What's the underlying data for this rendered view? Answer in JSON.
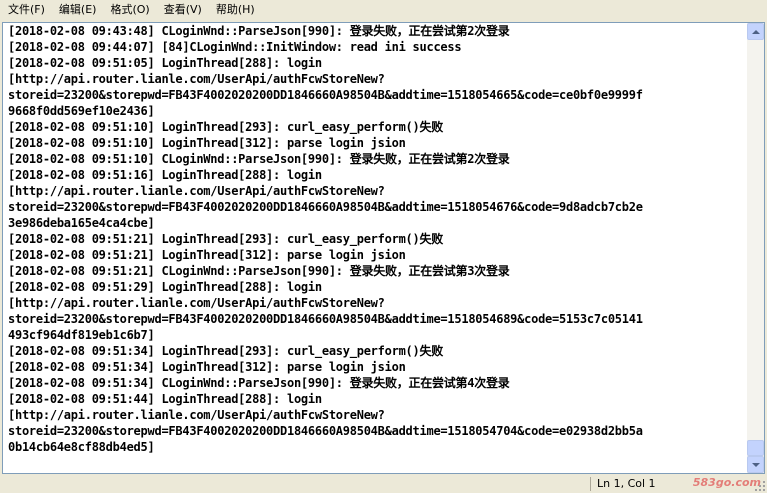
{
  "menu": {
    "items": [
      "文件(F)",
      "编辑(E)",
      "格式(O)",
      "查看(V)",
      "帮助(H)"
    ]
  },
  "log_lines": [
    "[2018-02-08 09:43:48] CLoginWnd::ParseJson[990]: 登录失败，正在尝试第2次登录",
    "[2018-02-08 09:44:07] [84]CLoginWnd::InitWindow: read ini success",
    "[2018-02-08 09:51:05] LoginThread[288]: login",
    "[http://api.router.lianle.com/UserApi/authFcwStoreNew?",
    "storeid=23200&storepwd=FB43F4002020200DD1846660A98504B&addtime=1518054665&code=ce0bf0e9999f",
    "9668f0dd569ef10e2436]",
    "[2018-02-08 09:51:10] LoginThread[293]: curl_easy_perform()失败",
    "[2018-02-08 09:51:10] LoginThread[312]: parse login jsion",
    "[2018-02-08 09:51:10] CLoginWnd::ParseJson[990]: 登录失败，正在尝试第2次登录",
    "[2018-02-08 09:51:16] LoginThread[288]: login",
    "[http://api.router.lianle.com/UserApi/authFcwStoreNew?",
    "storeid=23200&storepwd=FB43F4002020200DD1846660A98504B&addtime=1518054676&code=9d8adcb7cb2e",
    "3e986deba165e4ca4cbe]",
    "[2018-02-08 09:51:21] LoginThread[293]: curl_easy_perform()失败",
    "[2018-02-08 09:51:21] LoginThread[312]: parse login jsion",
    "[2018-02-08 09:51:21] CLoginWnd::ParseJson[990]: 登录失败，正在尝试第3次登录",
    "[2018-02-08 09:51:29] LoginThread[288]: login",
    "[http://api.router.lianle.com/UserApi/authFcwStoreNew?",
    "storeid=23200&storepwd=FB43F4002020200DD1846660A98504B&addtime=1518054689&code=5153c7c05141",
    "493cf964df819eb1c6b7]",
    "[2018-02-08 09:51:34] LoginThread[293]: curl_easy_perform()失败",
    "[2018-02-08 09:51:34] LoginThread[312]: parse login jsion",
    "[2018-02-08 09:51:34] CLoginWnd::ParseJson[990]: 登录失败，正在尝试第4次登录",
    "[2018-02-08 09:51:44] LoginThread[288]: login",
    "[http://api.router.lianle.com/UserApi/authFcwStoreNew?",
    "storeid=23200&storepwd=FB43F4002020200DD1846660A98504B&addtime=1518054704&code=e02938d2bb5a",
    "0b14cb64e8cf88db4ed5]"
  ],
  "status": {
    "position": "Ln 1, Col 1"
  },
  "watermark": "583go.com",
  "icons": {
    "scroll_up": "arrow-up-icon",
    "scroll_down": "arrow-down-icon",
    "resize": "resize-grip-icon"
  }
}
